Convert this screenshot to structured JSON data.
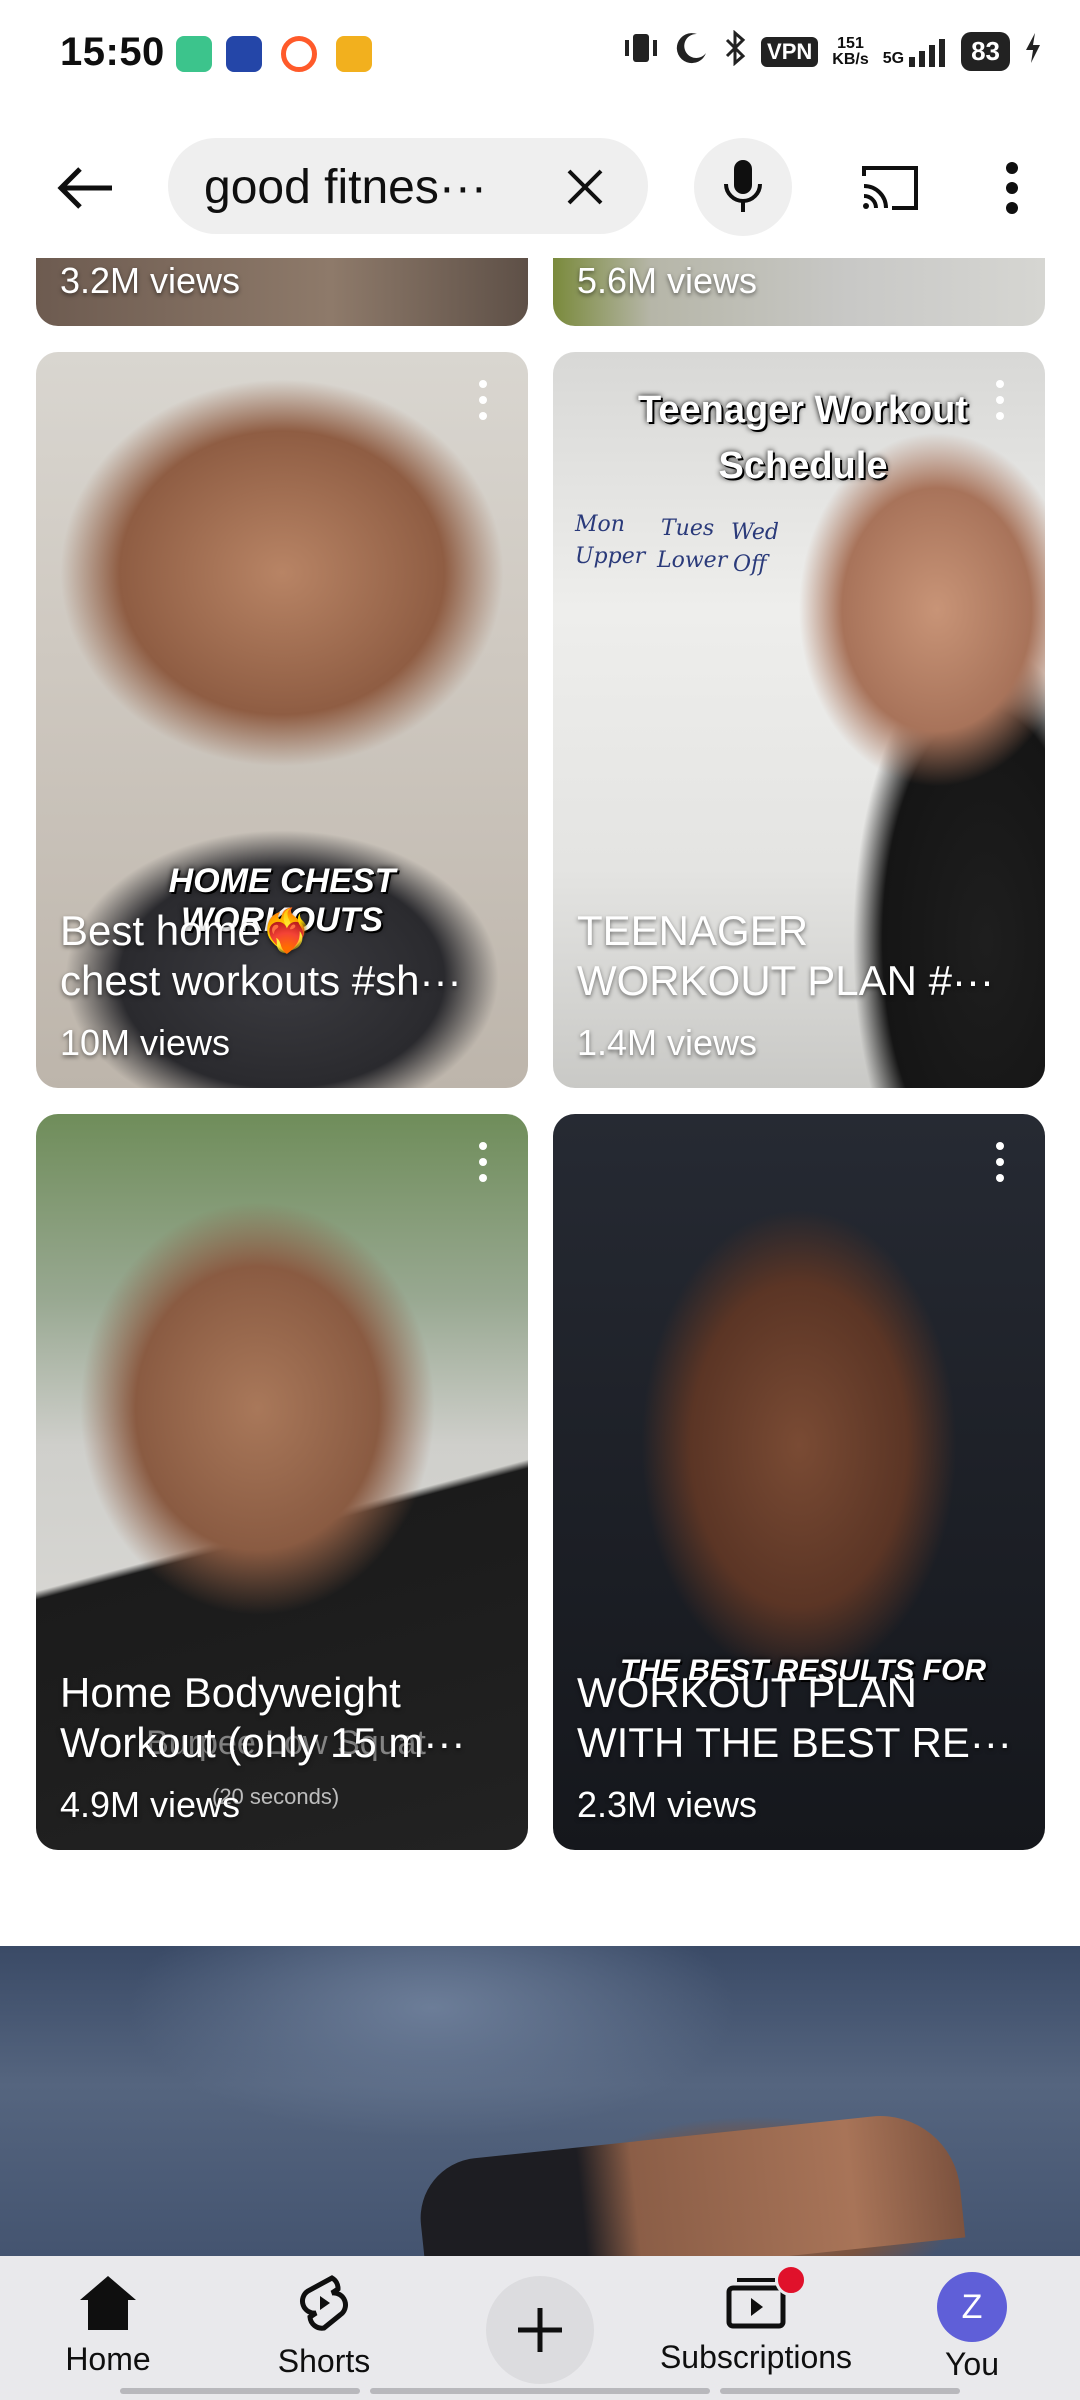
{
  "status_bar": {
    "time": "15:50",
    "vpn": "VPN",
    "speed_value": "151",
    "speed_unit": "KB/s",
    "network": "5G",
    "battery": "83"
  },
  "header": {
    "search_value": "good fitnes···"
  },
  "top_partial_cards": [
    {
      "views": "3.2M views"
    },
    {
      "views": "5.6M views"
    }
  ],
  "shorts": [
    {
      "title": "Best home❤️‍🔥\nchest workouts #sh···",
      "views": "10M views",
      "overlay": "HOME CHEST WORKOUTS"
    },
    {
      "title": "TEENAGER\nWORKOUT PLAN #···",
      "views": "1.4M views",
      "overlay": "Teenager Workout\nSchedule",
      "board": [
        "Mon",
        "Upper",
        "Tues",
        "Lower",
        "Wed",
        "Off"
      ]
    },
    {
      "title": "Home Bodyweight\nWorkout (only 15 m···",
      "views": "4.9M views",
      "overlay": "Burpee Low Squat",
      "overlay_small": "(20 seconds)"
    },
    {
      "title": "WORKOUT PLAN\nWITH THE BEST RE···",
      "views": "2.3M views",
      "overlay": "THE BEST RESULTS FOR"
    }
  ],
  "bottom_nav": {
    "home": "Home",
    "shorts": "Shorts",
    "subscriptions": "Subscriptions",
    "you": "You",
    "avatar_letter": "Z"
  },
  "colors": {
    "accent_red": "#e0112b",
    "avatar": "#5f5fd8",
    "nav_bg": "#e9e9ec",
    "pill_bg": "#efefef"
  }
}
